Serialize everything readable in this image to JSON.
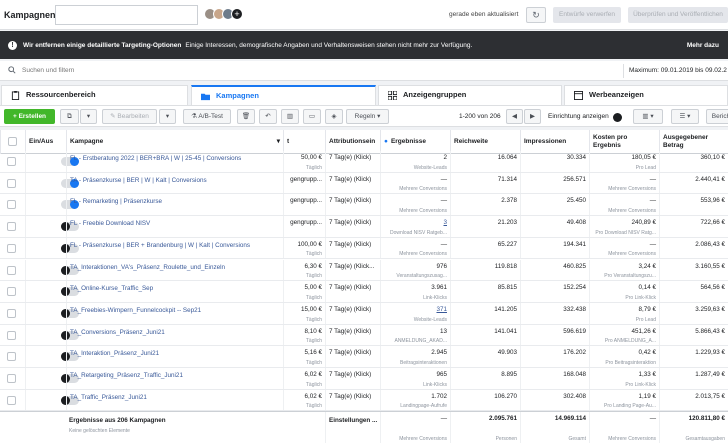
{
  "app": {
    "title": "Kampagnen",
    "updated": "gerade eben aktualisiert",
    "discard": "Entwürfe verwerfen",
    "publish": "Überprüfen und Veröffentlichen"
  },
  "banner": {
    "bold": "Wir entfernen einige detaillierte Targeting-Optionen",
    "text": "Einige Interessen, demografische Angaben und Verhaltensweisen stehen nicht mehr zur Verfügung.",
    "more": "Mehr dazu"
  },
  "search": {
    "placeholder": "Suchen und filtern",
    "daterange": "Maximum: 09.01.2019 bis 09.02.2"
  },
  "tabs": {
    "t1": "Ressourcenbereich",
    "t2": "Kampagnen",
    "t3": "Anzeigengruppen",
    "t4": "Werbeanzeigen"
  },
  "toolbar": {
    "create": "+ Erstellen",
    "edit": "Bearbeiten",
    "abtest": "A/B-Test",
    "rules": "Regeln",
    "pager": "1-200 von 206",
    "breakdown": "Einrichtung anzeigen",
    "report": "Berich"
  },
  "columns": {
    "onoff": "Ein/Aus",
    "campaign": "Kampagne",
    "t": "t",
    "attribution": "Attributionsein",
    "results": "Ergebnisse",
    "reach": "Reichweite",
    "impressions": "Impressionen",
    "cpr": "Kosten pro Ergebnis",
    "spend": "Ausgegebener Betrag"
  },
  "colors": {
    "accent": "#1877f2",
    "create": "#42b72a",
    "banner": "#2d2f33"
  },
  "rows": [
    {
      "on": true,
      "name": "FL - Erstberatung 2022 | BER+BRA | W | 25-45 | Conversions",
      "budget": "50,00 €",
      "bsub": "Täglich",
      "attr": "7 Tag(e) (Klick)",
      "res": "2",
      "ressub": "Website-Leads",
      "resl": false,
      "reach": "16.064",
      "impr": "30.334",
      "cpr": "180,05 €",
      "cprsub": "Pro Lead",
      "spend": "360,10 €"
    },
    {
      "on": true,
      "name": "TA - Präsenzkurse | BER | W | Kalt | Conversions",
      "budget": "gengrupp...",
      "bsub": "",
      "attr": "7 Tag(e) (Klick)",
      "res": "—",
      "ressub": "Mehrere Conversions",
      "resl": false,
      "reach": "71.314",
      "impr": "256.571",
      "cpr": "—",
      "cprsub": "Mehrere Conversions",
      "spend": "2.440,41 €"
    },
    {
      "on": true,
      "name": "FL - Remarketing | Präsenzkurse",
      "budget": "gengrupp...",
      "bsub": "",
      "attr": "7 Tag(e) (Klick)",
      "res": "—",
      "ressub": "Mehrere Conversions",
      "resl": false,
      "reach": "2.378",
      "impr": "25.450",
      "cpr": "—",
      "cprsub": "Mehrere Conversions",
      "spend": "553,96 €"
    },
    {
      "on": false,
      "name": "FL - Freebie Download NISV",
      "budget": "gengrupp...",
      "bsub": "",
      "attr": "7 Tag(e) (Klick)",
      "res": "3",
      "ressub": "Download NISV Ratgeb...",
      "resl": true,
      "reach": "21.203",
      "impr": "49.408",
      "cpr": "240,89 €",
      "cprsub": "Pro Download NISV Ratg...",
      "spend": "722,66 €"
    },
    {
      "on": false,
      "name": "FL - Präsenzkurse | BER + Brandenburg | W | Kalt | Conversions",
      "budget": "100,00 €",
      "bsub": "Täglich",
      "attr": "7 Tag(e) (Klick)",
      "res": "—",
      "ressub": "Mehrere Conversions",
      "resl": false,
      "reach": "65.227",
      "impr": "194.341",
      "cpr": "—",
      "cprsub": "Mehrere Conversions",
      "spend": "2.086,43 €"
    },
    {
      "on": false,
      "name": "TA_Interaktionen_VA's_Präsenz_Roulette_und_Einzeln",
      "budget": "6,30 €",
      "bsub": "Täglich",
      "attr": "7 Tag(e) (Klick...",
      "res": "976",
      "ressub": "Veranstaltungszusag...",
      "resl": false,
      "reach": "119.818",
      "impr": "460.825",
      "cpr": "3,24 €",
      "cprsub": "Pro Veranstaltungszu...",
      "spend": "3.160,55 €"
    },
    {
      "on": false,
      "name": "TA_Online-Kurse_Traffic_Sep",
      "budget": "5,00 €",
      "bsub": "Täglich",
      "attr": "7 Tag(e) (Klick)",
      "res": "3.961",
      "ressub": "Link-Klicks",
      "resl": false,
      "reach": "85.815",
      "impr": "152.254",
      "cpr": "0,14 €",
      "cprsub": "Pro Link-Klick",
      "spend": "564,56 €"
    },
    {
      "on": false,
      "name": "TA_Freebies-Wimpern_Funnelcockpit -- Sep21",
      "budget": "15,00 €",
      "bsub": "Täglich",
      "attr": "7 Tag(e) (Klick)",
      "res": "371",
      "ressub": "Website-Leads",
      "resl": true,
      "reach": "141.205",
      "impr": "332.438",
      "cpr": "8,79 €",
      "cprsub": "Pro Lead",
      "spend": "3.259,63 €"
    },
    {
      "on": false,
      "name": "TA_Conversions_Präsenz_Juni21",
      "budget": "8,10 €",
      "bsub": "Täglich",
      "attr": "7 Tag(e) (Klick)",
      "res": "13",
      "ressub": "ANMELDUNG_AKAD...",
      "resl": false,
      "reach": "141.041",
      "impr": "596.619",
      "cpr": "451,26 €",
      "cprsub": "Pro ANMELDUNG_A...",
      "spend": "5.866,43 €"
    },
    {
      "on": false,
      "name": "TA_Interaktion_Präsenz_Juni21",
      "budget": "5,16 €",
      "bsub": "Täglich",
      "attr": "7 Tag(e) (Klick)",
      "res": "2.945",
      "ressub": "Beitragsinteraktionen",
      "resl": false,
      "reach": "49.903",
      "impr": "176.202",
      "cpr": "0,42 €",
      "cprsub": "Pro Beitragsinteraktion",
      "spend": "1.229,93 €"
    },
    {
      "on": false,
      "name": "TA_Retargeting_Präsenz_Traffic_Juni21",
      "budget": "6,02 €",
      "bsub": "Täglich",
      "attr": "7 Tag(e) (Klick)",
      "res": "965",
      "ressub": "Link-Klicks",
      "resl": false,
      "reach": "8.895",
      "impr": "168.048",
      "cpr": "1,33 €",
      "cprsub": "Pro Link-Klick",
      "spend": "1.287,49 €"
    },
    {
      "on": false,
      "name": "TA_Traffic_Präsenz_Juni21",
      "budget": "6,02 €",
      "bsub": "Täglich",
      "attr": "7 Tag(e) (Klick)",
      "res": "1.702",
      "ressub": "Landingpage-Aufrufe",
      "resl": false,
      "reach": "106.270",
      "impr": "302.408",
      "cpr": "1,19 €",
      "cprsub": "Pro Landing Page-Au...",
      "spend": "2.013,75 €"
    }
  ],
  "footer": {
    "label": "Ergebnisse aus 206 Kampagnen",
    "sub": "Keine gelöschten Elemente",
    "attr": "Einstellungen ...",
    "res": "—",
    "ressub": "Mehrere Conversions",
    "reach": "2.095.761",
    "reachsub": "Personen",
    "impr": "14.969.114",
    "imprsub": "Gesamt",
    "cpr": "—",
    "cprsub": "Mehrere Conversions",
    "spend": "120.811,80 €",
    "spendsub": "Gesamtausgaben"
  }
}
